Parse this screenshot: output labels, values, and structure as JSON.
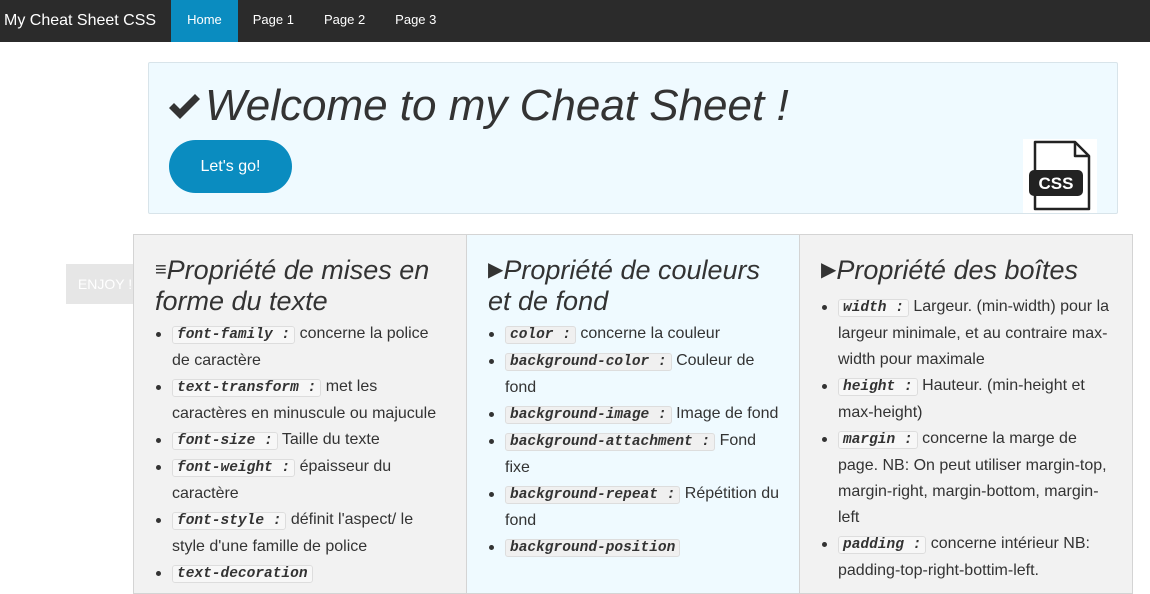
{
  "navbar": {
    "brand": "My Cheat Sheet CSS",
    "items": [
      {
        "label": "Home",
        "active": true
      },
      {
        "label": "Page 1"
      },
      {
        "label": "Page 2"
      },
      {
        "label": "Page 3"
      }
    ]
  },
  "jumbotron": {
    "title": "Welcome to my Cheat Sheet !",
    "button_label": "Let's go!",
    "css_icon_label": "CSS"
  },
  "badge": "ENJOY !",
  "columns": [
    {
      "title": "Propriété de mises en forme du texte",
      "icon": "list-icon",
      "items": [
        {
          "code": "font-family :",
          "text": "concerne la police de caractère"
        },
        {
          "code": "text-transform :",
          "text": "met les caractères en minuscule ou majucule"
        },
        {
          "code": "font-size :",
          "text": "Taille du texte"
        },
        {
          "code": "font-weight :",
          "text": "épaisseur du caractère"
        },
        {
          "code": "font-style :",
          "text": "définit l'aspect/ le style d'une famille de police"
        },
        {
          "code": "text-decoration",
          "text": ""
        }
      ]
    },
    {
      "title": "Propriété de couleurs et de fond",
      "icon": "play-icon",
      "items": [
        {
          "code": "color :",
          "text": "concerne la couleur"
        },
        {
          "code": "background-color :",
          "text": "Couleur de fond"
        },
        {
          "code": "background-image :",
          "text": "Image de fond"
        },
        {
          "code": "background-attachment :",
          "text": "Fond fixe"
        },
        {
          "code": "background-repeat :",
          "text": "Répétition du fond"
        },
        {
          "code": "background-position",
          "text": ""
        }
      ]
    },
    {
      "title": "Propriété des boîtes",
      "icon": "play-icon",
      "items": [
        {
          "code": "width :",
          "text": "Largeur. (min-width) pour la largeur minimale, et au contraire max-width pour maximale"
        },
        {
          "code": "height :",
          "text": "Hauteur. (min-height et max-height)"
        },
        {
          "code": "margin :",
          "text": "concerne la marge de page. NB: On peut utiliser margin-top, margin-right, margin-bottom, margin-left"
        },
        {
          "code": "padding :",
          "text": "concerne intérieur NB: padding-top-right-bottim-left."
        }
      ]
    }
  ],
  "colors": {
    "navbar": "#2b2b2b",
    "accent": "#0a8cc0",
    "jumbotron_bg": "#effaff",
    "column_bg": "#f2f2f2"
  }
}
